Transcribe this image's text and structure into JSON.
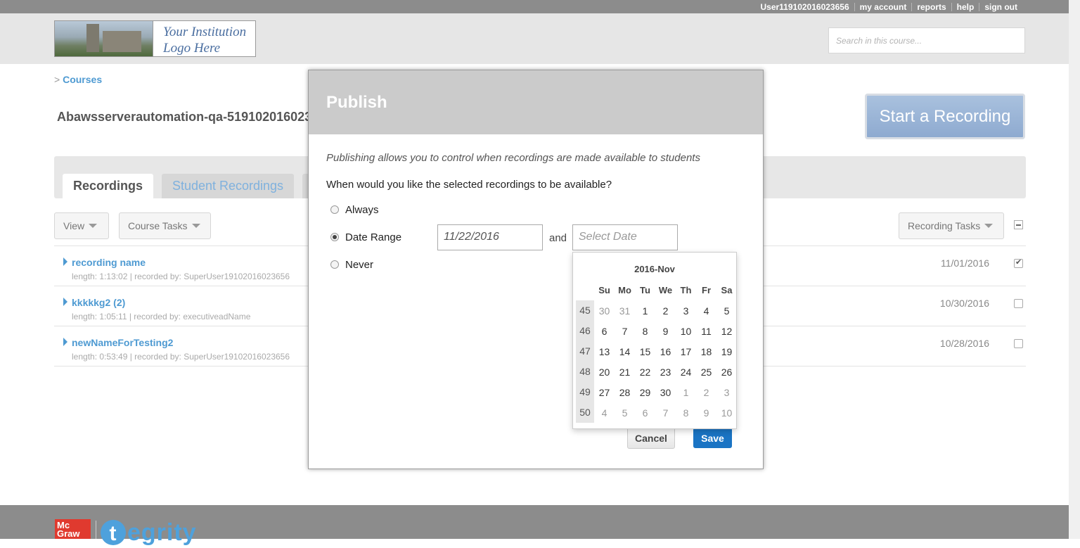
{
  "topbar": {
    "user": "User119102016023656",
    "links": [
      "my account",
      "reports",
      "help",
      "sign out"
    ]
  },
  "header": {
    "logo_line1": "Your Institution",
    "logo_line2": "Logo Here",
    "search_placeholder": "Search in this course..."
  },
  "breadcrumb": {
    "prefix": ">",
    "link": "Courses"
  },
  "course_title": "Abawsserverautomation-qa-519102016023",
  "start_recording": "Start a Recording",
  "tabs": [
    "Recordings",
    "Student Recordings"
  ],
  "toolbar": {
    "view": "View",
    "course_tasks": "Course Tasks",
    "recording_tasks": "Recording Tasks"
  },
  "recordings": [
    {
      "name": "recording name",
      "meta": "length: 1:13:02 | recorded by: SuperUser19102016023656",
      "date": "11/01/2016",
      "checked": true
    },
    {
      "name": "kkkkkg2 (2)",
      "meta": "length: 1:05:11 | recorded by: executiveadName",
      "date": "10/30/2016",
      "checked": false
    },
    {
      "name": "newNameForTesting2",
      "meta": "length: 0:53:49 | recorded by: SuperUser19102016023656",
      "date": "10/28/2016",
      "checked": false
    }
  ],
  "footer": {
    "mh_line1": "Mc",
    "mh_line2": "Graw",
    "brand": "tegrity",
    "brand_initial": "t",
    "brand_rest": "egrity"
  },
  "modal": {
    "title": "Publish",
    "intro": "Publishing allows you to control when recordings are made available to students",
    "question": "When would you like the selected recordings to be available?",
    "options": [
      "Always",
      "Date Range",
      "Never"
    ],
    "selected_option": "Date Range",
    "start_date": "11/22/2016",
    "and_label": "and",
    "end_placeholder": "Select Date",
    "cancel": "Cancel",
    "save": "Save"
  },
  "calendar": {
    "title": "2016-Nov",
    "prev_icon": "",
    "next_icon": "",
    "weekdays": [
      "Su",
      "Mo",
      "Tu",
      "We",
      "Th",
      "Fr",
      "Sa"
    ],
    "weeks": [
      {
        "num": "45",
        "days": [
          "30",
          "31",
          "1",
          "2",
          "3",
          "4",
          "5"
        ]
      },
      {
        "num": "46",
        "days": [
          "6",
          "7",
          "8",
          "9",
          "10",
          "11",
          "12"
        ]
      },
      {
        "num": "47",
        "days": [
          "13",
          "14",
          "15",
          "16",
          "17",
          "18",
          "19"
        ]
      },
      {
        "num": "48",
        "days": [
          "20",
          "21",
          "22",
          "23",
          "24",
          "25",
          "26"
        ]
      },
      {
        "num": "49",
        "days": [
          "27",
          "28",
          "29",
          "30",
          "1",
          "2",
          "3"
        ]
      },
      {
        "num": "50",
        "days": [
          "4",
          "5",
          "6",
          "7",
          "8",
          "9",
          "10"
        ]
      }
    ]
  }
}
